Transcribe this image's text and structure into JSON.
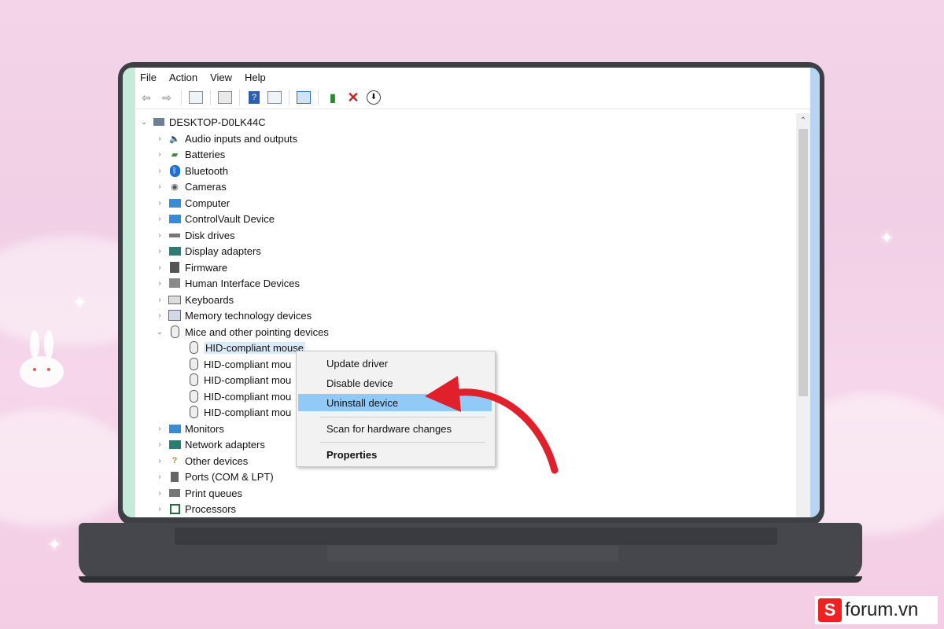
{
  "menu": [
    "File",
    "Action",
    "View",
    "Help"
  ],
  "tree": {
    "root": "DESKTOP-D0LK44C",
    "items": [
      {
        "label": "Audio inputs and outputs",
        "icon": "speaker-icon",
        "expanded": false
      },
      {
        "label": "Batteries",
        "icon": "battery-icon",
        "expanded": false
      },
      {
        "label": "Bluetooth",
        "icon": "bluetooth-icon",
        "expanded": false
      },
      {
        "label": "Cameras",
        "icon": "camera-icon",
        "expanded": false
      },
      {
        "label": "Computer",
        "icon": "computer-icon",
        "expanded": false
      },
      {
        "label": "ControlVault Device",
        "icon": "monitor-icon",
        "expanded": false
      },
      {
        "label": "Disk drives",
        "icon": "disk-icon",
        "expanded": false
      },
      {
        "label": "Display adapters",
        "icon": "display-adapter-icon",
        "expanded": false
      },
      {
        "label": "Firmware",
        "icon": "chip-icon",
        "expanded": false
      },
      {
        "label": "Human Interface Devices",
        "icon": "hid-icon",
        "expanded": false
      },
      {
        "label": "Keyboards",
        "icon": "keyboard-icon",
        "expanded": false
      },
      {
        "label": "Memory technology devices",
        "icon": "memory-icon",
        "expanded": false
      },
      {
        "label": "Mice and other pointing devices",
        "icon": "mouse-icon",
        "expanded": true,
        "children": [
          "HID-compliant mouse",
          "HID-compliant mou",
          "HID-compliant mou",
          "HID-compliant mou",
          "HID-compliant mou"
        ]
      },
      {
        "label": "Monitors",
        "icon": "monitor-icon",
        "expanded": false
      },
      {
        "label": "Network adapters",
        "icon": "network-icon",
        "expanded": false
      },
      {
        "label": "Other devices",
        "icon": "question-icon",
        "expanded": false
      },
      {
        "label": "Ports (COM & LPT)",
        "icon": "port-icon",
        "expanded": false
      },
      {
        "label": "Print queues",
        "icon": "printer-icon",
        "expanded": false
      },
      {
        "label": "Processors",
        "icon": "processor-icon",
        "expanded": false
      }
    ]
  },
  "context_menu": {
    "items": [
      "Update driver",
      "Disable device",
      "Uninstall device",
      "Scan for hardware changes",
      "Properties"
    ],
    "highlighted": "Uninstall device"
  },
  "colors": {
    "arrow": "#e0202a",
    "highlight": "#91c9f7",
    "brand": "#e22222"
  },
  "brand": {
    "text": "forum.vn",
    "logo": "S"
  }
}
